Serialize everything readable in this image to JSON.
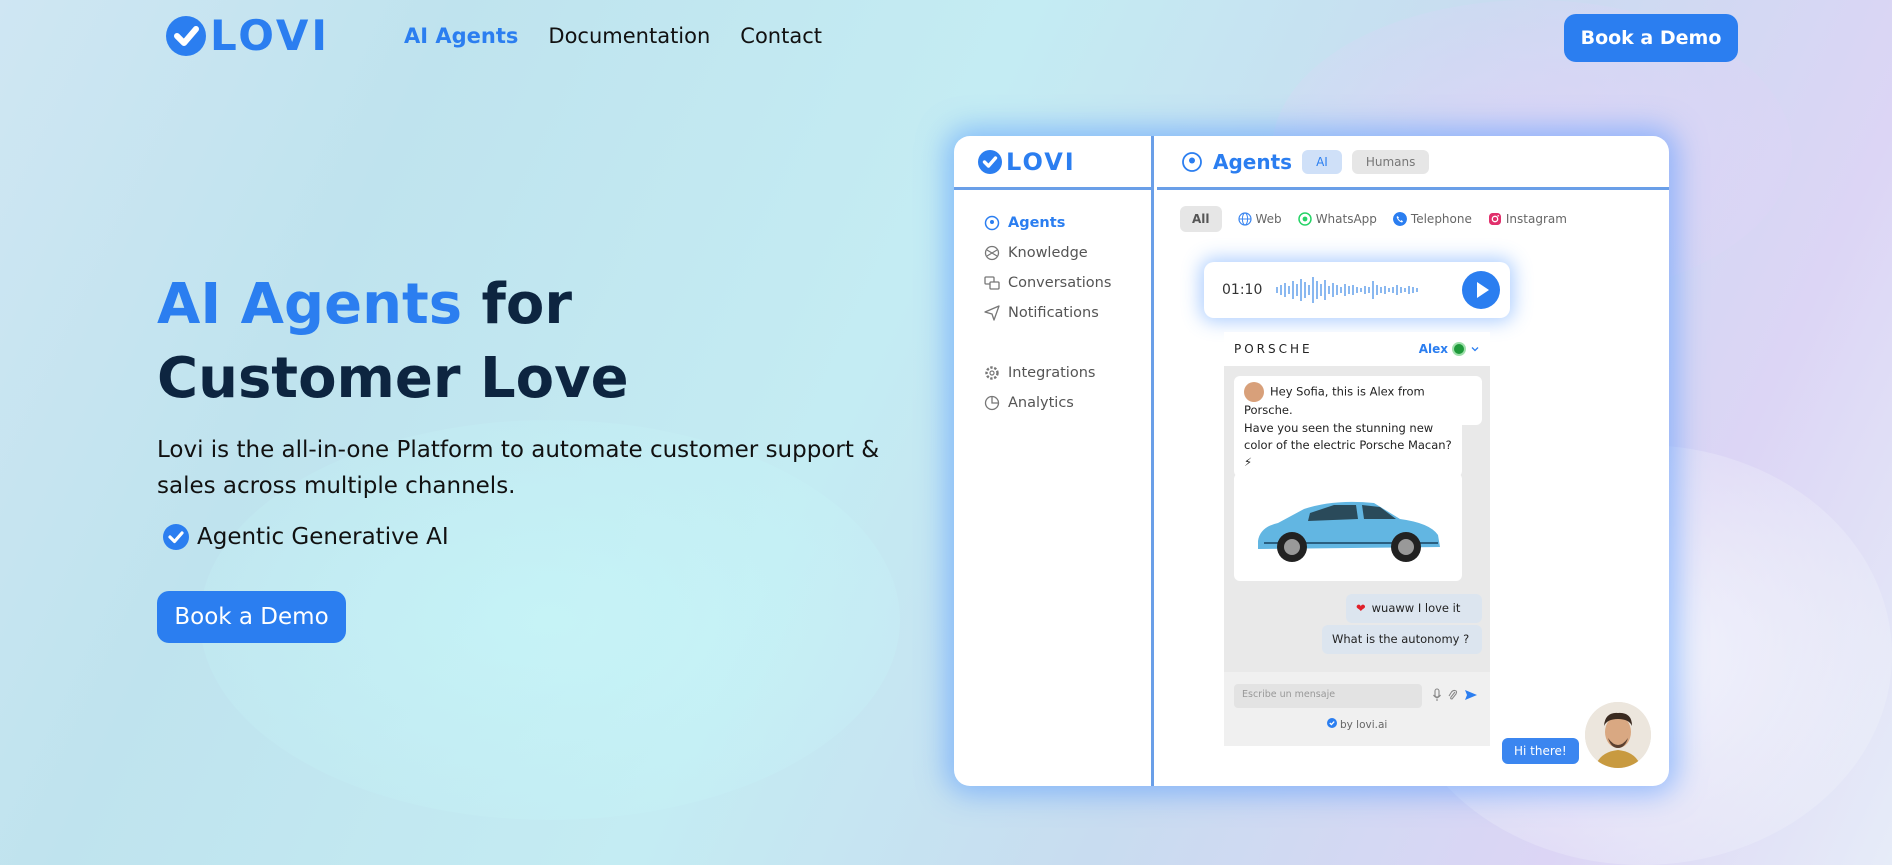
{
  "nav": {
    "logo_text": "LOVI",
    "links": [
      {
        "label": "AI Agents",
        "active": true
      },
      {
        "label": "Documentation",
        "active": false
      },
      {
        "label": "Contact",
        "active": false
      }
    ],
    "cta_label": "Book a Demo"
  },
  "hero": {
    "title_accent": "AI Agents",
    "title_rest_1": " for",
    "title_line_2": "Customer Love",
    "description": "Lovi is the all-in-one Platform to automate customer support & sales across multiple channels.",
    "feature": "Agentic Generative AI",
    "cta_label": "Book a Demo"
  },
  "mockup": {
    "logo_text": "LOVI",
    "header_title": "Agents",
    "header_pills": [
      "AI",
      "Humans"
    ],
    "sidebar": [
      {
        "label": "Agents",
        "icon": "agents-icon",
        "active": true
      },
      {
        "label": "Knowledge",
        "icon": "knowledge-icon",
        "active": false
      },
      {
        "label": "Conversations",
        "icon": "conversations-icon",
        "active": false
      },
      {
        "label": "Notifications",
        "icon": "notifications-icon",
        "active": false
      },
      {
        "label": "Integrations",
        "icon": "integrations-icon",
        "active": false
      },
      {
        "label": "Analytics",
        "icon": "analytics-icon",
        "active": false
      }
    ],
    "channels": {
      "all": "All",
      "items": [
        {
          "label": "Web",
          "color": "#3b86f0"
        },
        {
          "label": "WhatsApp",
          "color": "#25d366"
        },
        {
          "label": "Telephone",
          "color": "#2b7ef0"
        },
        {
          "label": "Instagram",
          "color": "#e1306c"
        }
      ]
    },
    "audio": {
      "time": "01:10"
    },
    "chat": {
      "brand": "PORSCHE",
      "agent_name": "Alex",
      "messages": {
        "m1": "Hey Sofia, this is Alex from Porsche.",
        "m2": "Have you seen the stunning new color of the electric Porsche Macan? ⚡",
        "u1": "wuaww I love it",
        "u2": "What is the autonomy ?"
      },
      "input_placeholder": "Escribe un mensaje",
      "powered_by": "by lovi.ai"
    },
    "greeting": "Hi there!"
  }
}
